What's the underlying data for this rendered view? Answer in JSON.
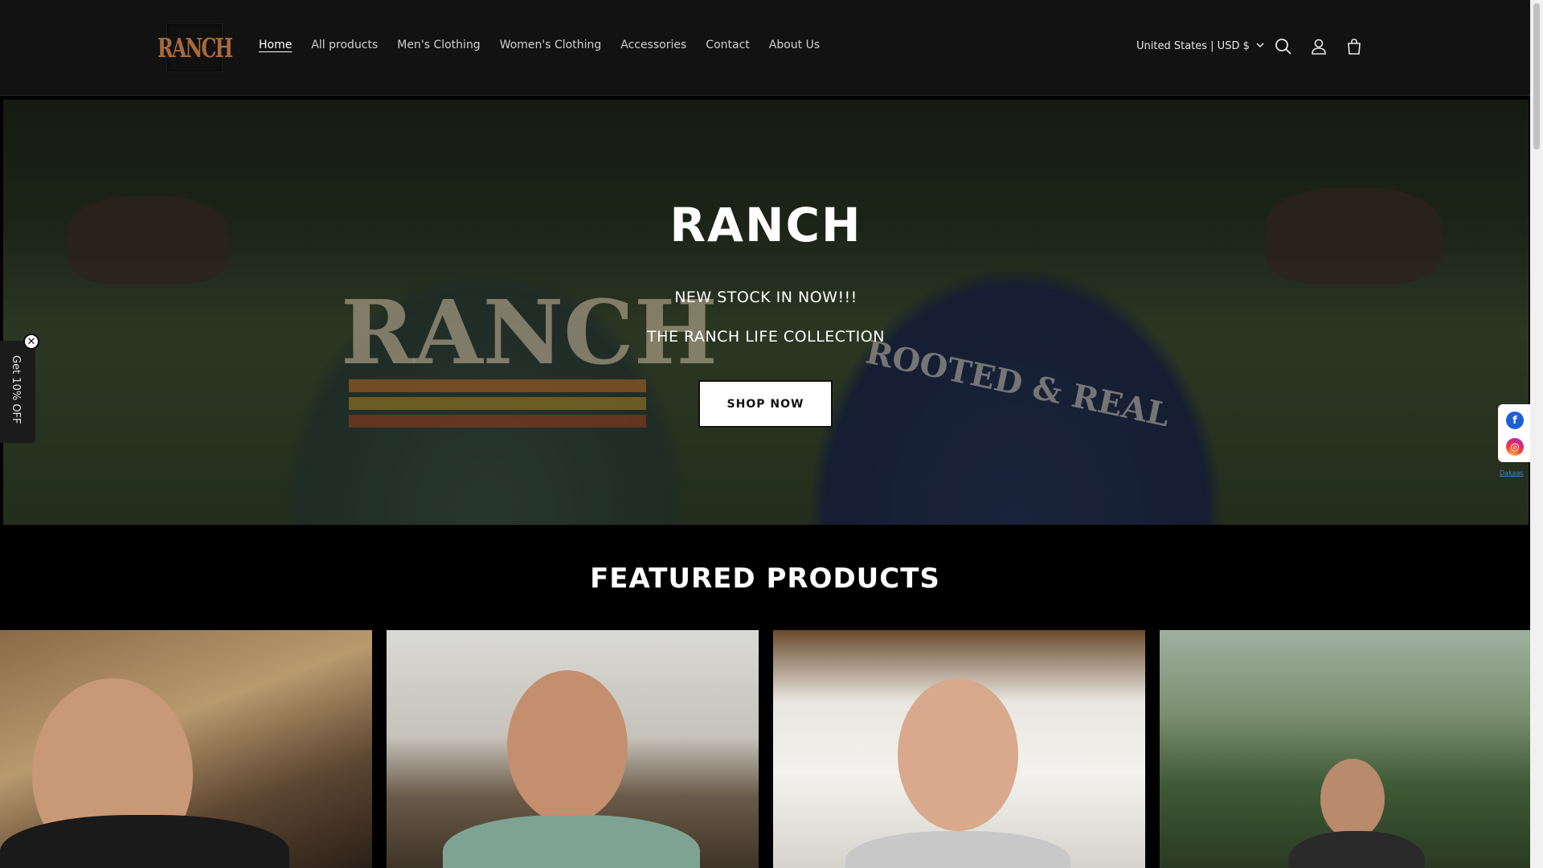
{
  "header": {
    "logo_text": "RANCH",
    "nav": [
      {
        "label": "Home",
        "active": true
      },
      {
        "label": "All products"
      },
      {
        "label": "Men's Clothing"
      },
      {
        "label": "Women's Clothing"
      },
      {
        "label": "Accessories"
      },
      {
        "label": "Contact"
      },
      {
        "label": "About Us"
      }
    ],
    "country_selector": "United States | USD $",
    "icons": [
      "search-icon",
      "account-icon",
      "cart-icon"
    ]
  },
  "hero": {
    "title": "RANCH",
    "subtitle_1": "NEW STOCK IN NOW!!!",
    "subtitle_2": "THE RANCH LIFE COLLECTION",
    "button": "SHOP NOW",
    "shirt_text_left": "RANCH",
    "shirt_text_right": "ROOTED & REAL"
  },
  "featured": {
    "title": "FEATURED PRODUCTS"
  },
  "discount_tab": {
    "label": "Get 10% OFF",
    "close": "✕"
  },
  "social": {
    "facebook": "f",
    "instagram": "◎",
    "link_text": "Dakaas"
  },
  "colors": {
    "header_bg": "#121212",
    "page_bg": "#000000",
    "button_bg": "#ffffff"
  }
}
